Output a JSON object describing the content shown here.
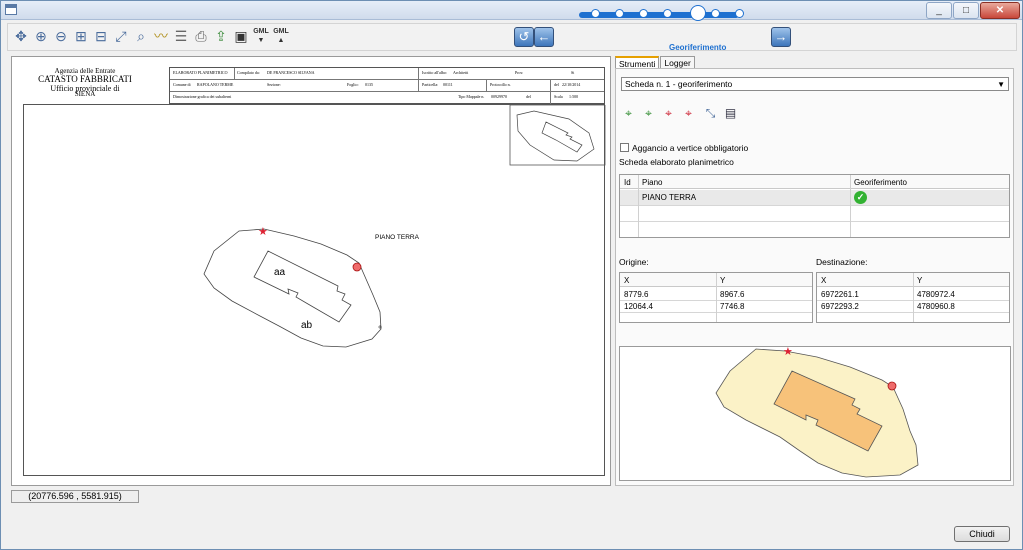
{
  "window": {
    "minimize_glyph": "_",
    "maximize_glyph": "□",
    "close_glyph": "✕"
  },
  "toolbar": {
    "icons": [
      "pan-icon",
      "zoom-in-icon",
      "zoom-out-icon",
      "zoom-window-icon",
      "zoom-prev-icon",
      "zoom-extent-icon",
      "zoom-selection-icon",
      "measure-icon",
      "layers-icon",
      "print-icon",
      "export-icon",
      "id-card-icon",
      "gml-import-icon",
      "gml-export-icon"
    ],
    "gml_label_1": "GML",
    "gml_label_2": "GML",
    "step_back_glyph": "↺",
    "step_prev_glyph": "←",
    "step_next_glyph": "→",
    "wizard_step_label": "Georiferimento",
    "wizard_progress": "5 of 7"
  },
  "sheet": {
    "agency_line1": "Agenzia delle Entrate",
    "agency_line2": "CATASTO FABBRICATI",
    "agency_line3": "Ufficio provinciale di",
    "agency_line4": "SIENA",
    "hdr_r1": [
      "ELABORATO PLANIMETRICO",
      "Compilato da:",
      "DE FRANCESCO SILVANA",
      "Iscritto all'albo:",
      "Architetti",
      "Prov.",
      "Si"
    ],
    "hdr_r2": [
      "Comune di",
      "RAPOLANO TERME",
      "Sezione:",
      "Foglio:",
      "0135",
      "Particella:",
      "00111",
      "Protocollo n.",
      "del",
      "22/10/2014"
    ],
    "hdr_r3": [
      "Dimostrazione grafica dei subalterni",
      "Tipo Mappale n.",
      "00929970",
      "del",
      "Scala",
      "1:500"
    ],
    "floor_label": "PIANO TERRA",
    "room_a": "aa",
    "room_b": "ab"
  },
  "status": {
    "coordinates": "(20776.596 , 5581.915)"
  },
  "right": {
    "tabs": [
      "Strumenti",
      "Logger"
    ],
    "scheda_select": "Scheda n. 1 - georiferimento",
    "tools": [
      "add-point-1-icon",
      "add-point-2-icon",
      "remove-point-1-icon",
      "remove-point-2-icon",
      "transform-icon",
      "save-icon"
    ],
    "snap_label": "Aggancio a vertice obbligatorio",
    "scheda_title": "Scheda elaborato planimetrico",
    "plan_table": {
      "headers": [
        "Id",
        "Piano",
        "Georiferimento"
      ],
      "rows": [
        {
          "id": "",
          "piano": "PIANO TERRA",
          "geo": "ok"
        }
      ]
    },
    "origin_label": "Origine:",
    "dest_label": "Destinazione:",
    "origin_table": {
      "headers": [
        "X",
        "Y"
      ],
      "rows": [
        [
          "8779.6",
          "8967.6"
        ],
        [
          "12064.4",
          "7746.8"
        ]
      ]
    },
    "dest_table": {
      "headers": [
        "X",
        "Y"
      ],
      "rows": [
        [
          "6972261.1",
          "4780972.4"
        ],
        [
          "6972293.2",
          "4780960.8"
        ]
      ]
    }
  },
  "footer": {
    "close_label": "Chiudi"
  }
}
